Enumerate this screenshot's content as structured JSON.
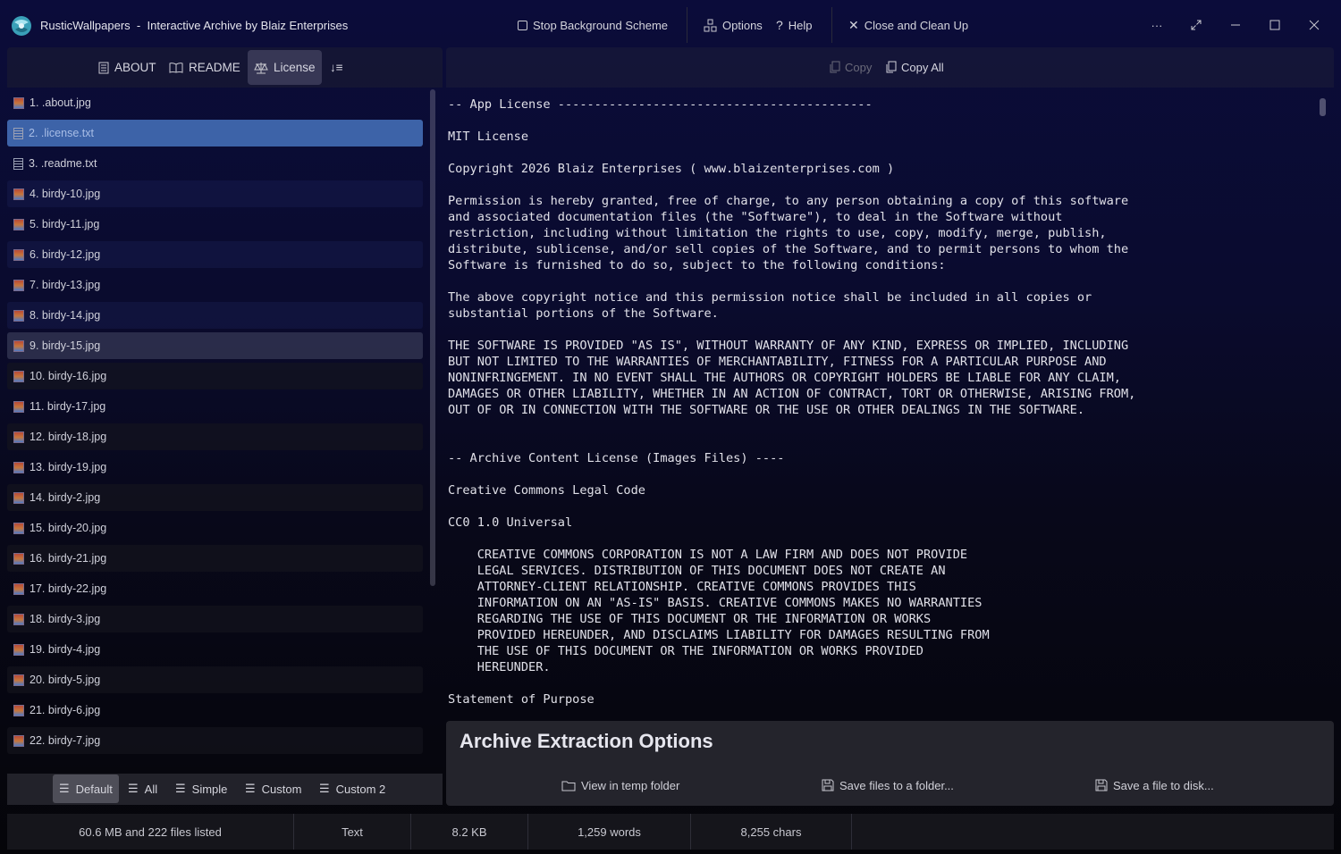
{
  "titlebar": {
    "app_name": "RusticWallpapers",
    "separator": "-",
    "subtitle": "Interactive Archive by Blaiz Enterprises",
    "stop_bg": "Stop Background Scheme",
    "options": "Options",
    "help": "Help",
    "close_clean": "Close and Clean Up",
    "more": "···"
  },
  "left_toolbar": {
    "about": "ABOUT",
    "readme": "README",
    "license": "License",
    "sort": "↓≡"
  },
  "files": [
    {
      "label": "1. .about.jpg",
      "type": "img"
    },
    {
      "label": "2. .license.txt",
      "type": "txt"
    },
    {
      "label": "3. .readme.txt",
      "type": "txt"
    },
    {
      "label": "4. birdy-10.jpg",
      "type": "img"
    },
    {
      "label": "5. birdy-11.jpg",
      "type": "img"
    },
    {
      "label": "6. birdy-12.jpg",
      "type": "img"
    },
    {
      "label": "7. birdy-13.jpg",
      "type": "img"
    },
    {
      "label": "8. birdy-14.jpg",
      "type": "img"
    },
    {
      "label": "9. birdy-15.jpg",
      "type": "img"
    },
    {
      "label": "10. birdy-16.jpg",
      "type": "img"
    },
    {
      "label": "11. birdy-17.jpg",
      "type": "img"
    },
    {
      "label": "12. birdy-18.jpg",
      "type": "img"
    },
    {
      "label": "13. birdy-19.jpg",
      "type": "img"
    },
    {
      "label": "14. birdy-2.jpg",
      "type": "img"
    },
    {
      "label": "15. birdy-20.jpg",
      "type": "img"
    },
    {
      "label": "16. birdy-21.jpg",
      "type": "img"
    },
    {
      "label": "17. birdy-22.jpg",
      "type": "img"
    },
    {
      "label": "18. birdy-3.jpg",
      "type": "img"
    },
    {
      "label": "19. birdy-4.jpg",
      "type": "img"
    },
    {
      "label": "20. birdy-5.jpg",
      "type": "img"
    },
    {
      "label": "21. birdy-6.jpg",
      "type": "img"
    },
    {
      "label": "22. birdy-7.jpg",
      "type": "img"
    }
  ],
  "bottom_tabs": {
    "default": "Default",
    "all": "All",
    "simple": "Simple",
    "custom": "Custom",
    "custom2": "Custom 2"
  },
  "right_toolbar": {
    "copy": "Copy",
    "copy_all": "Copy All"
  },
  "license_text": "-- App License -------------------------------------------\n\nMIT License\n\nCopyright 2026 Blaiz Enterprises ( www.blaizenterprises.com )\n\nPermission is hereby granted, free of charge, to any person obtaining a copy of this software\nand associated documentation files (the \"Software\"), to deal in the Software without\nrestriction, including without limitation the rights to use, copy, modify, merge, publish,\ndistribute, sublicense, and/or sell copies of the Software, and to permit persons to whom the\nSoftware is furnished to do so, subject to the following conditions:\n\nThe above copyright notice and this permission notice shall be included in all copies or\nsubstantial portions of the Software.\n\nTHE SOFTWARE IS PROVIDED \"AS IS\", WITHOUT WARRANTY OF ANY KIND, EXPRESS OR IMPLIED, INCLUDING\nBUT NOT LIMITED TO THE WARRANTIES OF MERCHANTABILITY, FITNESS FOR A PARTICULAR PURPOSE AND\nNONINFRINGEMENT. IN NO EVENT SHALL THE AUTHORS OR COPYRIGHT HOLDERS BE LIABLE FOR ANY CLAIM,\nDAMAGES OR OTHER LIABILITY, WHETHER IN AN ACTION OF CONTRACT, TORT OR OTHERWISE, ARISING FROM,\nOUT OF OR IN CONNECTION WITH THE SOFTWARE OR THE USE OR OTHER DEALINGS IN THE SOFTWARE.\n\n\n-- Archive Content License (Images Files) ----\n\nCreative Commons Legal Code\n\nCC0 1.0 Universal\n\n    CREATIVE COMMONS CORPORATION IS NOT A LAW FIRM AND DOES NOT PROVIDE\n    LEGAL SERVICES. DISTRIBUTION OF THIS DOCUMENT DOES NOT CREATE AN\n    ATTORNEY-CLIENT RELATIONSHIP. CREATIVE COMMONS PROVIDES THIS\n    INFORMATION ON AN \"AS-IS\" BASIS. CREATIVE COMMONS MAKES NO WARRANTIES\n    REGARDING THE USE OF THIS DOCUMENT OR THE INFORMATION OR WORKS\n    PROVIDED HEREUNDER, AND DISCLAIMS LIABILITY FOR DAMAGES RESULTING FROM\n    THE USE OF THIS DOCUMENT OR THE INFORMATION OR WORKS PROVIDED\n    HEREUNDER.\n\nStatement of Purpose",
  "extraction": {
    "title": "Archive Extraction Options",
    "view_temp": "View in temp folder",
    "save_folder": "Save files to a folder...",
    "save_disk": "Save a file to disk..."
  },
  "status": {
    "summary": "60.6 MB and 222 files listed",
    "type": "Text",
    "size": "8.2 KB",
    "words": "1,259 words",
    "chars": "8,255 chars"
  }
}
